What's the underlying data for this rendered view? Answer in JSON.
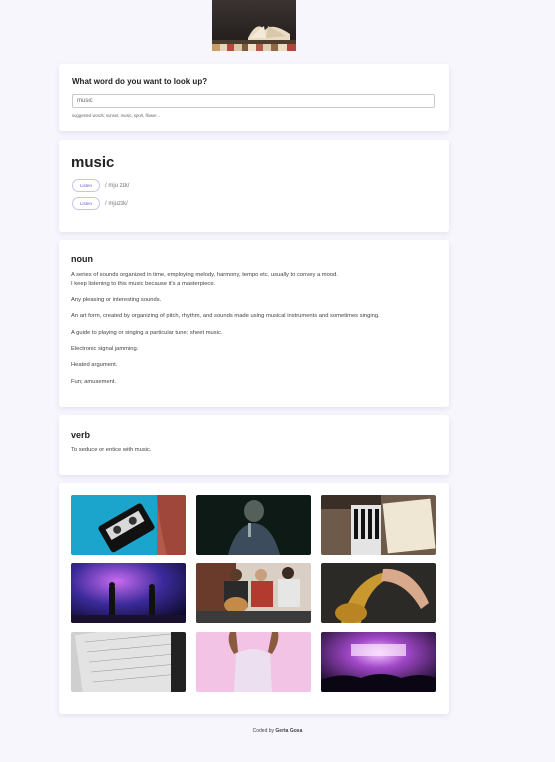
{
  "search": {
    "question": "What word do you want to look up?",
    "value": "music",
    "hint": "suggested words: sunset, music, sport, flower..."
  },
  "word": {
    "headword": "music",
    "phonetics": [
      {
        "listen_label": "Listen",
        "ipa": "/ mju zɪk/"
      },
      {
        "listen_label": "Listen",
        "ipa": "/ mjuzɪk/"
      }
    ]
  },
  "meanings": {
    "noun": {
      "part_of_speech": "noun",
      "definitions": [
        "A series of sounds organized in time, employing melody, harmony, tempo etc. usually to convey a mood.",
        "I keep listening to this music because it's a masterpiece.",
        "Any pleasing or interesting sounds.",
        "An art form, created by organizing of pitch, rhythm, and sounds made using musical instruments and sometimes singing.",
        "A guide to playing or singing a particular tune; sheet music.",
        "Electronic signal jamming.",
        "Heated argument.",
        "Fun; amusement."
      ]
    },
    "verb": {
      "part_of_speech": "verb",
      "definitions": [
        "To seduce or entice with music."
      ]
    }
  },
  "photos": [
    {
      "subject": "cassette tape on blue background"
    },
    {
      "subject": "singer with microphone"
    },
    {
      "subject": "keyboard and sheet music"
    },
    {
      "subject": "band performing on stage"
    },
    {
      "subject": "group playing guitar"
    },
    {
      "subject": "saxophone player"
    },
    {
      "subject": "sheet music pages"
    },
    {
      "subject": "person on pink background"
    },
    {
      "subject": "concert crowd and stage lights"
    }
  ],
  "footer": {
    "prefix": "Coded by",
    "author": "Gerta Gosa"
  },
  "colors": {
    "background": "#f7f6fd",
    "accent": "#6b5fce",
    "card": "#ffffff"
  }
}
